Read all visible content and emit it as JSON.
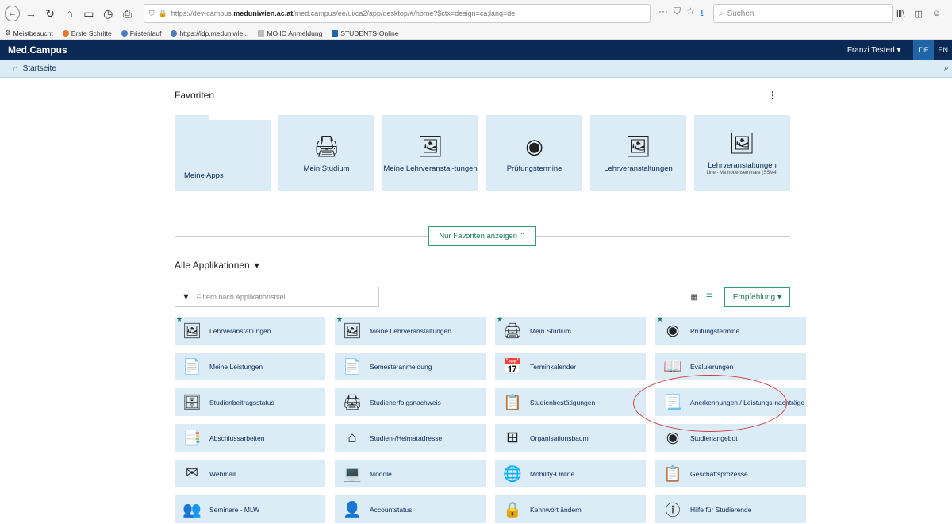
{
  "browser": {
    "url_prefix": "https://dev-campus.",
    "url_domain": "meduniwien.ac.at",
    "url_rest": "/med.campus/ee/ui/ca2/app/desktop/#/home?$ctx=design=ca;lang=de",
    "search_placeholder": "Suchen",
    "bookmarks": [
      "Meistbesucht",
      "Erste Schritte",
      "Fristenlauf",
      "https://idp.meduniwie...",
      "MO IO Anmeldung",
      "STUDENTS-Online"
    ]
  },
  "header": {
    "app_title": "Med.Campus",
    "user": "Franzi Testerl",
    "lang_de": "DE",
    "lang_en": "EN"
  },
  "breadcrumb": {
    "home": "Startseite"
  },
  "favorites": {
    "title": "Favoriten",
    "tiles": [
      {
        "label": "Meine Apps",
        "sub": "",
        "icon": "▭"
      },
      {
        "label": "Mein Studium",
        "sub": "",
        "icon": "🖨"
      },
      {
        "label": "Meine Lehrveranstal-tungen",
        "sub": "",
        "icon": "🖼"
      },
      {
        "label": "Prüfungstermine",
        "sub": "",
        "icon": "◉"
      },
      {
        "label": "Lehrveranstaltungen",
        "sub": "",
        "icon": "🖼"
      },
      {
        "label": "Lehrveranstaltungen",
        "sub": "Line - Methodenseminare (SSM4)",
        "icon": "🖼"
      }
    ],
    "toggle_label": "Nur Favoriten anzeigen"
  },
  "all_apps": {
    "title": "Alle Applikationen",
    "filter_placeholder": "Filtern nach Applikationstitel...",
    "sort_label": "Empfehlung",
    "apps": [
      {
        "label": "Lehrveranstaltungen",
        "icon": "🖼",
        "fav": true
      },
      {
        "label": "Meine Lehrveranstaltungen",
        "icon": "🖼",
        "fav": true
      },
      {
        "label": "Mein Studium",
        "icon": "🖨",
        "fav": true
      },
      {
        "label": "Prüfungstermine",
        "icon": "◉",
        "fav": true
      },
      {
        "label": "Meine Leistungen",
        "icon": "📄",
        "fav": false
      },
      {
        "label": "Semesteranmeldung",
        "icon": "📄",
        "fav": false
      },
      {
        "label": "Terminkalender",
        "icon": "📅",
        "fav": false
      },
      {
        "label": "Evaluierungen",
        "icon": "📖",
        "fav": false
      },
      {
        "label": "Studienbeitragsstatus",
        "icon": "🗄",
        "fav": false
      },
      {
        "label": "Studienerfolgsnachweis",
        "icon": "🖨",
        "fav": false
      },
      {
        "label": "Studienbestätigungen",
        "icon": "📋",
        "fav": false
      },
      {
        "label": "Anerkennungen / Leistungs-nachträge",
        "icon": "📃",
        "fav": false
      },
      {
        "label": "Abschlussarbeiten",
        "icon": "📑",
        "fav": false
      },
      {
        "label": "Studien-/Heimatadresse",
        "icon": "⌂",
        "fav": false
      },
      {
        "label": "Organisationsbaum",
        "icon": "⊞",
        "fav": false
      },
      {
        "label": "Studienangebot",
        "icon": "◉",
        "fav": false
      },
      {
        "label": "Webmail",
        "icon": "✉",
        "fav": false
      },
      {
        "label": "Moodle",
        "icon": "💻",
        "fav": false
      },
      {
        "label": "Mobility-Online",
        "icon": "🌐",
        "fav": false
      },
      {
        "label": "Geschäftsprozesse",
        "icon": "📋",
        "fav": false
      },
      {
        "label": "Seminare - MLW",
        "icon": "👥",
        "fav": false
      },
      {
        "label": "Accountstatus",
        "icon": "👤",
        "fav": false
      },
      {
        "label": "Kennwort ändern",
        "icon": "🔒",
        "fav": false
      },
      {
        "label": "Hilfe für Studierende",
        "icon": "ⓘ",
        "fav": false
      }
    ]
  }
}
